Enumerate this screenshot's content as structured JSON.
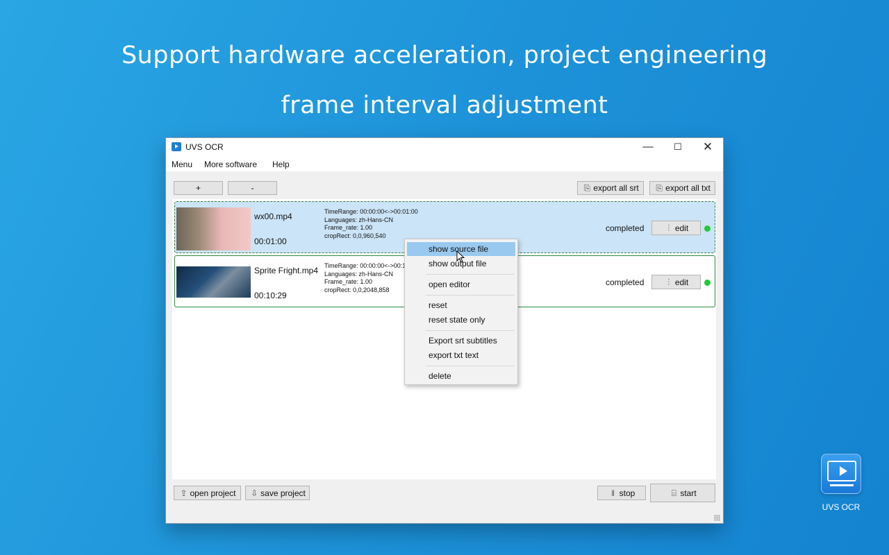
{
  "headline": {
    "line1": "Support hardware acceleration, project engineering",
    "line2": "frame interval adjustment"
  },
  "window": {
    "title": "UVS OCR",
    "controls": {
      "minimize": "—",
      "maximize": "☐",
      "close": "✕"
    }
  },
  "menubar": {
    "items": [
      "Menu",
      "More software",
      "Help"
    ]
  },
  "toolbar": {
    "add_label": "+",
    "remove_label": "-",
    "export_all_srt": "export all srt",
    "export_all_txt": "export all txt"
  },
  "files": [
    {
      "name": "wx00.mp4",
      "duration": "00:01:00",
      "time_range": "TimeRange: 00:00:00<->00:01:00",
      "languages": "Languages: zh-Hans-CN",
      "frame_rate": "Frame_rate: 1.00",
      "crop_rect": "cropRect: 0,0,960,540",
      "status": "completed",
      "edit_label": "edit",
      "selected": true
    },
    {
      "name": "Sprite Fright.mp4",
      "duration": "00:10:29",
      "time_range": "TimeRange: 00:00:00<->00:1",
      "languages": "Languages: zh-Hans-CN",
      "frame_rate": "Frame_rate: 1.00",
      "crop_rect": "cropRect: 0,0,2048,858",
      "status": "completed",
      "edit_label": "edit",
      "selected": false
    }
  ],
  "context_menu": {
    "items": [
      "show source file",
      "show output file",
      "open editor",
      "reset",
      "reset state only",
      "Export srt subtitles",
      "export txt text",
      "delete"
    ],
    "highlighted": "show source file"
  },
  "bottom_bar": {
    "open_project": "open project",
    "save_project": "save project",
    "stop": "stop",
    "start": "start"
  },
  "dock": {
    "label": "UVS OCR"
  },
  "colors": {
    "background": "#1e93d9",
    "selected_row": "#cce4f7",
    "row_border": "#2b8a3e",
    "status_dot": "#22c93a",
    "menu_highlight": "#99c9ef"
  }
}
